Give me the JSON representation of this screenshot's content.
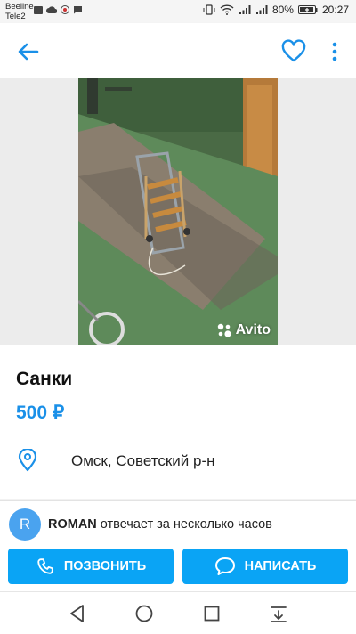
{
  "status_bar": {
    "carrier1": "Beeline",
    "carrier2": "Tele2",
    "battery": "80%",
    "time": "20:27"
  },
  "listing": {
    "title": "Санки",
    "price": "500 ₽",
    "location": "Омск, Советский р-н",
    "watermark": "Avito"
  },
  "seller": {
    "avatar_letter": "R",
    "name": "ROMAN",
    "response_time": "отвечает за несколько часов"
  },
  "actions": {
    "call_label": "ПОЗВОНИТЬ",
    "message_label": "НАПИСАТЬ"
  },
  "icons": {
    "back": "arrow-left",
    "favorite": "heart-outline",
    "more": "vertical-dots",
    "location": "location-pin",
    "phone": "phone",
    "chat": "chat-bubble"
  },
  "colors": {
    "accent": "#0aa4f5",
    "price": "#1a90e8",
    "avatar": "#4aa3ef"
  }
}
